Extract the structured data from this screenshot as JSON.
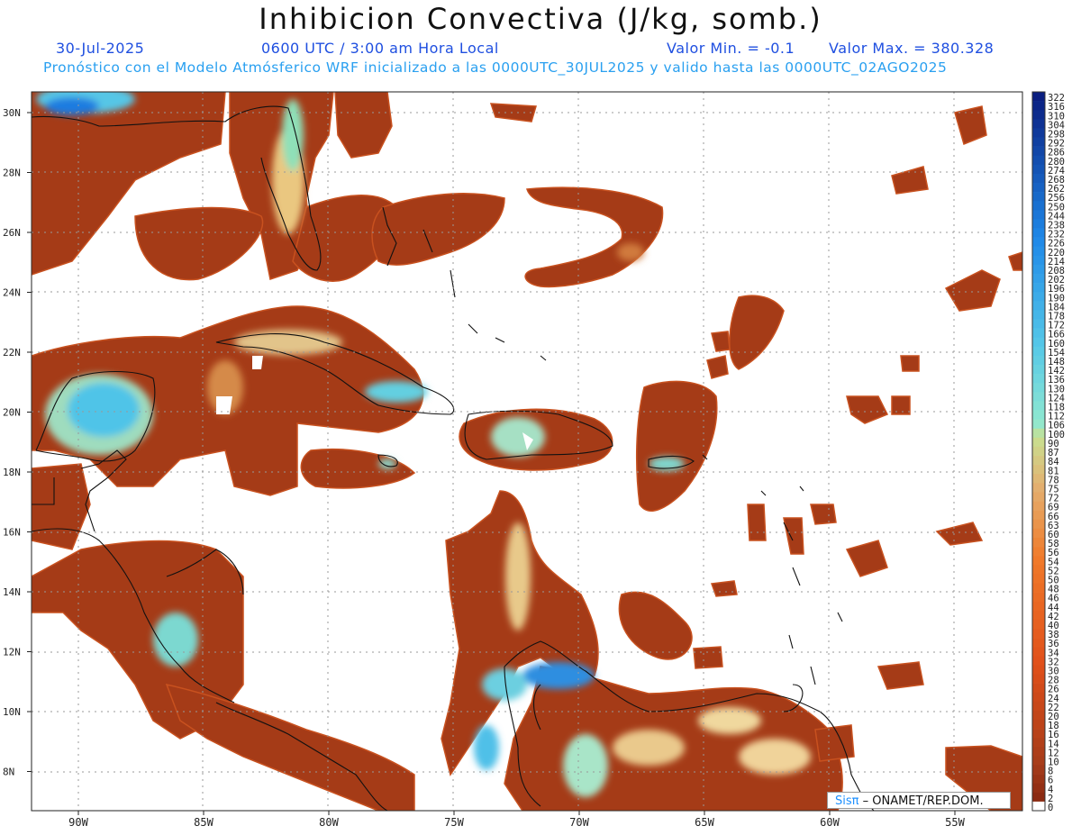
{
  "title": "Inhibicion Convectiva (J/kg, somb.)",
  "header": {
    "date": "30-Jul-2025",
    "time": "0600 UTC / 3:00 am Hora Local",
    "min_label": "Valor Min. = -0.1",
    "max_label": "Valor Max. = 380.328",
    "forecast_info": "Pronóstico con el Modelo Atmósferico WRF inicializado a las 0000UTC_30JUL2025 y valido hasta las  0000UTC_02AGO2025"
  },
  "credit": {
    "brand": "Sisπ",
    "text": "– ONAMET/REP.DOM."
  },
  "colors": {
    "title_blue": "#1f4fe0",
    "info_blue": "#2aa0f0",
    "cin_low": "#a83a16",
    "cin_mid": "#e8c98c",
    "cin_high": "#1563d8"
  },
  "map": {
    "lon_ticks": [
      "90W",
      "85W",
      "80W",
      "75W",
      "70W",
      "65W",
      "60W",
      "55W"
    ],
    "lat_ticks": [
      "30N",
      "28N",
      "26N",
      "24N",
      "22N",
      "20N",
      "18N",
      "16N",
      "14N",
      "12N",
      "10N",
      "8N"
    ]
  },
  "colorbar": {
    "labels": [
      "322",
      "316",
      "310",
      "304",
      "298",
      "292",
      "286",
      "280",
      "274",
      "268",
      "262",
      "256",
      "250",
      "244",
      "238",
      "232",
      "226",
      "220",
      "214",
      "208",
      "202",
      "196",
      "190",
      "184",
      "178",
      "172",
      "166",
      "160",
      "154",
      "148",
      "142",
      "136",
      "130",
      "124",
      "118",
      "112",
      "106",
      "100",
      "90",
      "87",
      "84",
      "81",
      "78",
      "75",
      "72",
      "69",
      "66",
      "63",
      "60",
      "58",
      "56",
      "54",
      "52",
      "50",
      "48",
      "46",
      "44",
      "42",
      "40",
      "38",
      "36",
      "34",
      "32",
      "30",
      "28",
      "26",
      "24",
      "22",
      "20",
      "18",
      "16",
      "14",
      "12",
      "10",
      "8",
      "6",
      "4",
      "2",
      "0"
    ]
  }
}
